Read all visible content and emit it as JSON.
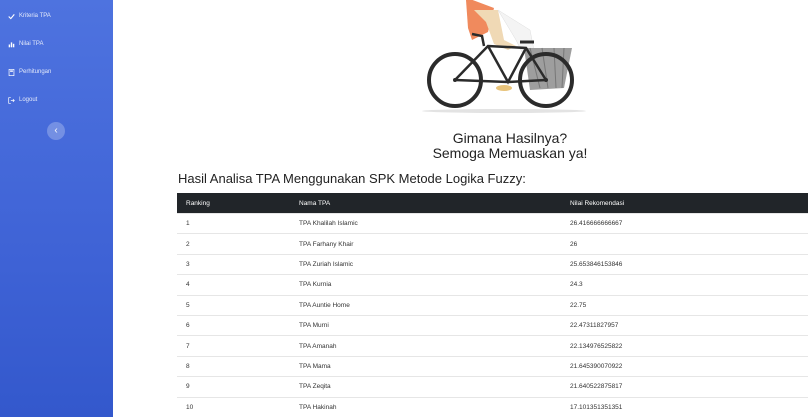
{
  "sidebar": {
    "items": [
      {
        "label": "Kriteria TPA",
        "icon": "check-icon"
      },
      {
        "label": "Nilai TPA",
        "icon": "chart-icon"
      },
      {
        "label": "Perhitungan",
        "icon": "calculator-icon"
      },
      {
        "label": "Logout",
        "icon": "logout-icon"
      }
    ],
    "toggle_glyph": "‹"
  },
  "message": {
    "line1": "Gimana Hasilnya?",
    "line2": "Semoga Memuaskan ya!"
  },
  "section_title": "Hasil Analisa TPA Menggunakan SPK Metode Logika Fuzzy:",
  "table": {
    "headers": [
      "Ranking",
      "Nama TPA",
      "Nilai Rekomendasi"
    ],
    "rows": [
      [
        "1",
        "TPA Khalilah Islamic",
        "26.416666666667"
      ],
      [
        "2",
        "TPA Farhany Khair",
        "26"
      ],
      [
        "3",
        "TPA Zuriah Islamic",
        "25.653846153846"
      ],
      [
        "4",
        "TPA Kurnia",
        "24.3"
      ],
      [
        "5",
        "TPA Auntie Home",
        "22.75"
      ],
      [
        "6",
        "TPA Murni",
        "22.47311827957"
      ],
      [
        "7",
        "TPA Amanah",
        "22.134976525822"
      ],
      [
        "8",
        "TPA Mama",
        "21.645390070922"
      ],
      [
        "9",
        "TPA Zeqita",
        "21.640522875817"
      ],
      [
        "10",
        "TPA Hakinah",
        "17.101351351351"
      ]
    ]
  },
  "colors": {
    "sidebar": "#4e73df",
    "table_header": "#212529"
  }
}
